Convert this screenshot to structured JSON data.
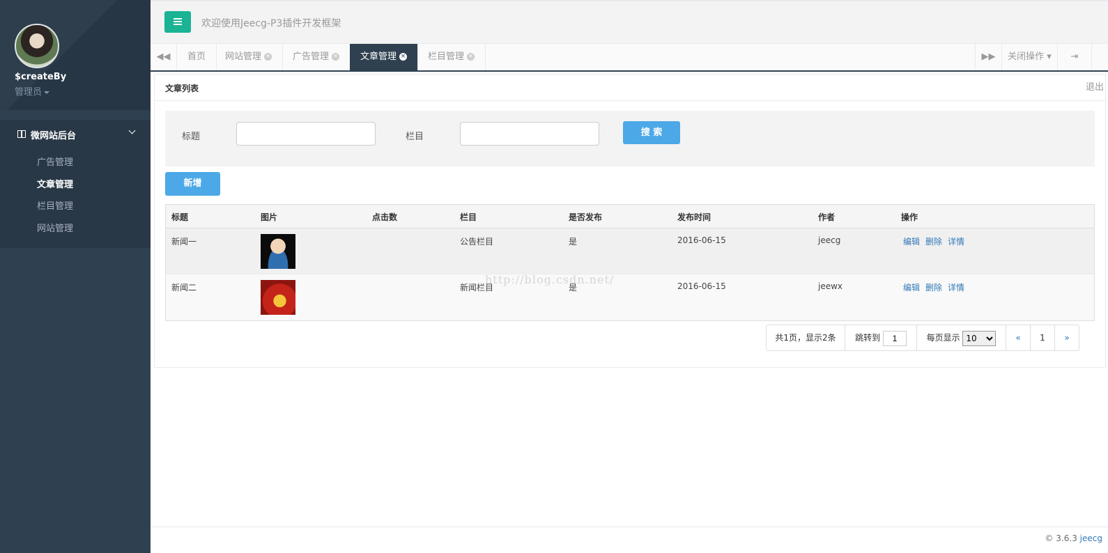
{
  "sidebar": {
    "user_name": "$createBy",
    "user_role": "管理员",
    "nav_header": "微网站后台",
    "items": [
      {
        "label": "广告管理",
        "active": false
      },
      {
        "label": "文章管理",
        "active": true
      },
      {
        "label": "栏目管理",
        "active": false
      },
      {
        "label": "网站管理",
        "active": false
      }
    ]
  },
  "header": {
    "welcome": "欢迎使用Jeecg-P3插件开发框架"
  },
  "tabs": [
    {
      "label": "首页",
      "closable": false,
      "active": false
    },
    {
      "label": "网站管理",
      "closable": true,
      "active": false
    },
    {
      "label": "广告管理",
      "closable": true,
      "active": false
    },
    {
      "label": "文章管理",
      "closable": true,
      "active": true
    },
    {
      "label": "栏目管理",
      "closable": true,
      "active": false
    }
  ],
  "tab_ops": {
    "close_ops": "关闭操作"
  },
  "panel": {
    "title": "文章列表",
    "exit": "退出"
  },
  "search": {
    "title_label": "标题",
    "column_label": "栏目",
    "search_button": "搜 索",
    "title_value": "",
    "column_value": ""
  },
  "add_button": "新增",
  "table": {
    "headers": [
      "标题",
      "图片",
      "点击数",
      "栏目",
      "是否发布",
      "发布时间",
      "作者",
      "操作"
    ],
    "rows": [
      {
        "title": "新闻一",
        "image": "user-avatar-thumbnail",
        "clicks": "",
        "column": "公告栏目",
        "published": "是",
        "date": "2016-06-15",
        "author": "jeecg"
      },
      {
        "title": "新闻二",
        "image": "red-gift-thumbnail",
        "clicks": "",
        "column": "新闻栏目",
        "published": "是",
        "date": "2016-06-15",
        "author": "jeewx"
      }
    ],
    "actions": [
      "编辑",
      "删除",
      "详情"
    ]
  },
  "watermark": "http://blog.csdn.net/",
  "pagination": {
    "summary": "共1页，显示2条",
    "jump_label": "跳转到",
    "jump_value": "1",
    "per_page_label": "每页显示",
    "per_page_value": "10",
    "prev": "«",
    "page": "1",
    "next": "»"
  },
  "footer": {
    "copyright": "© 3.6.3",
    "brand": "jeecg"
  },
  "colors": {
    "sidebar": "#2f4050",
    "accent_green": "#1ab394",
    "button_blue": "#4ca8e6",
    "link_blue": "#337ab7"
  }
}
